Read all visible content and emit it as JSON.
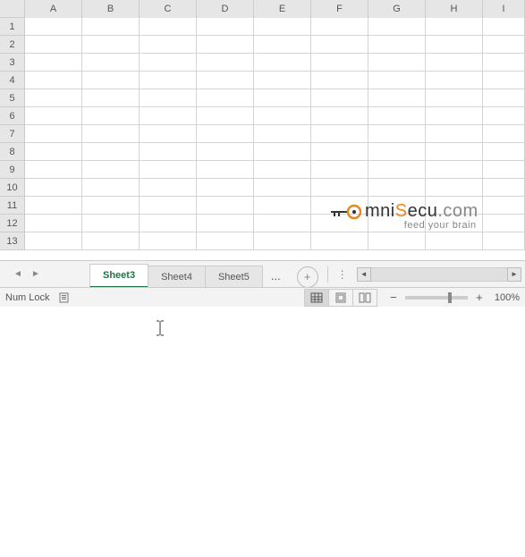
{
  "grid": {
    "columns": [
      "A",
      "B",
      "C",
      "D",
      "E",
      "F",
      "G",
      "H",
      "I"
    ],
    "rows": [
      1,
      2,
      3,
      4,
      5,
      6,
      7,
      8,
      9,
      10,
      11,
      12,
      13
    ]
  },
  "tabs": {
    "items": [
      {
        "label": "Sheet3",
        "active": true
      },
      {
        "label": "Sheet4",
        "active": false
      },
      {
        "label": "Sheet5",
        "active": false
      }
    ],
    "more": "..."
  },
  "status": {
    "numlock": "Num Lock",
    "zoom_label": "100%"
  },
  "watermark": {
    "prefix": "mni",
    "suffix": "ecu",
    "dotcom": ".com",
    "tagline": "feed your brain"
  }
}
